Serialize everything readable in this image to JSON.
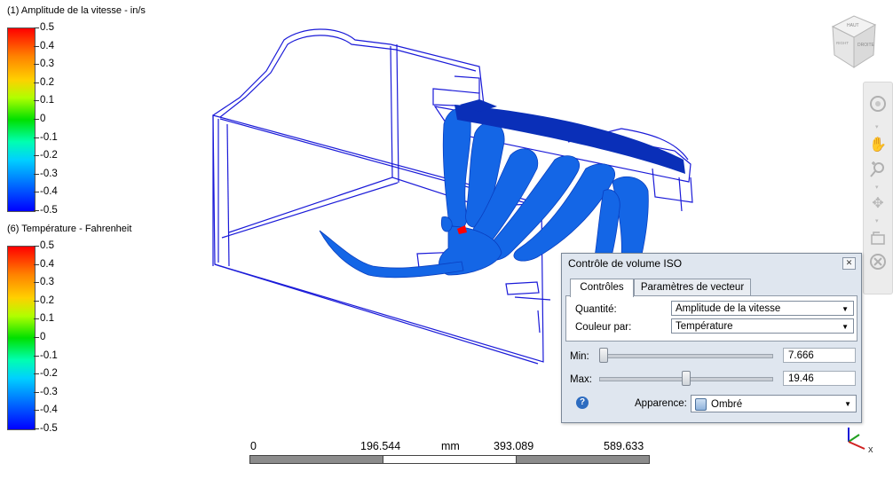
{
  "legend_velocity": {
    "title": "(1) Amplitude de la vitesse - in/s",
    "labels": [
      "0.5",
      "0.4",
      "0.3",
      "0.2",
      "0.1",
      "0",
      "-0.1",
      "-0.2",
      "-0.3",
      "-0.4",
      "-0.5"
    ]
  },
  "legend_temperature": {
    "title": "(6) Température - Fahrenheit",
    "labels": [
      "0.5",
      "0.4",
      "0.3",
      "0.2",
      "0.1",
      "0",
      "-0.1",
      "-0.2",
      "-0.3",
      "-0.4",
      "-0.5"
    ]
  },
  "viewcube": {
    "top": "HAUT",
    "front": "DROITE",
    "right": "RIGHT"
  },
  "scalebar": {
    "labels": [
      "0",
      "196.544",
      "mm",
      "393.089",
      "589.633"
    ]
  },
  "dialog": {
    "title": "Contrôle de volume ISO",
    "tabs": [
      "Contrôles",
      "Paramètres de vecteur"
    ],
    "quantity_label": "Quantité:",
    "quantity_value": "Amplitude de la vitesse",
    "color_label": "Couleur par:",
    "color_value": "Température",
    "min_label": "Min:",
    "min_value": "7.666",
    "min_level": 0.0,
    "max_label": "Max:",
    "max_value": "19.46",
    "max_level": 0.48,
    "appearance_label": "Apparence:",
    "appearance_value": "Ombré",
    "help_glyph": "?"
  },
  "axis": {
    "x": "x"
  },
  "colors": {
    "wireframe": "#1a1ad8",
    "iso_surface": "#1466e6",
    "iso_dark": "#0a2fb8",
    "accent_red": "#ff0000"
  },
  "icons": [
    "orbit-icon",
    "pan-icon",
    "zoom-icon",
    "fit-icon",
    "walk-icon",
    "close-circle-icon"
  ]
}
